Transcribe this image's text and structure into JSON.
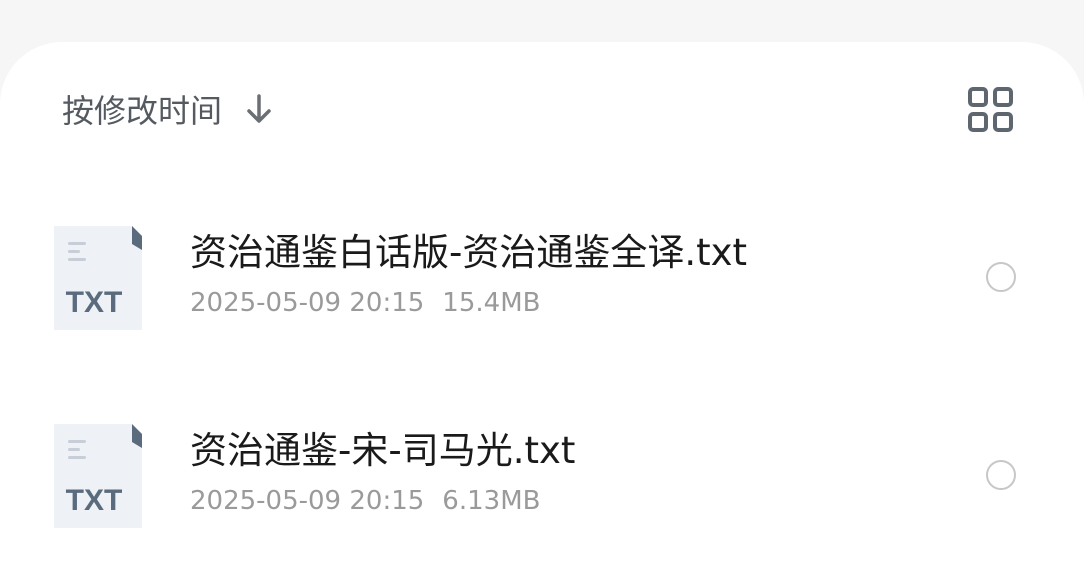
{
  "sort": {
    "label": "按修改时间",
    "direction_icon": "arrow-down-icon"
  },
  "view_toggle": {
    "icon": "grid-view-icon"
  },
  "files": [
    {
      "name": "资治通鉴白话版-资治通鉴全译.txt",
      "modified": "2025-05-09 20:15",
      "size": "15.4MB",
      "type_label": "TXT",
      "selected": false
    },
    {
      "name": "资治通鉴-宋-司马光.txt",
      "modified": "2025-05-09 20:15",
      "size": "6.13MB",
      "type_label": "TXT",
      "selected": false
    }
  ],
  "colors": {
    "icon_badge": "#5b6b7e",
    "meta_text": "#9a9a9a",
    "title_text": "#1a1a1a"
  }
}
